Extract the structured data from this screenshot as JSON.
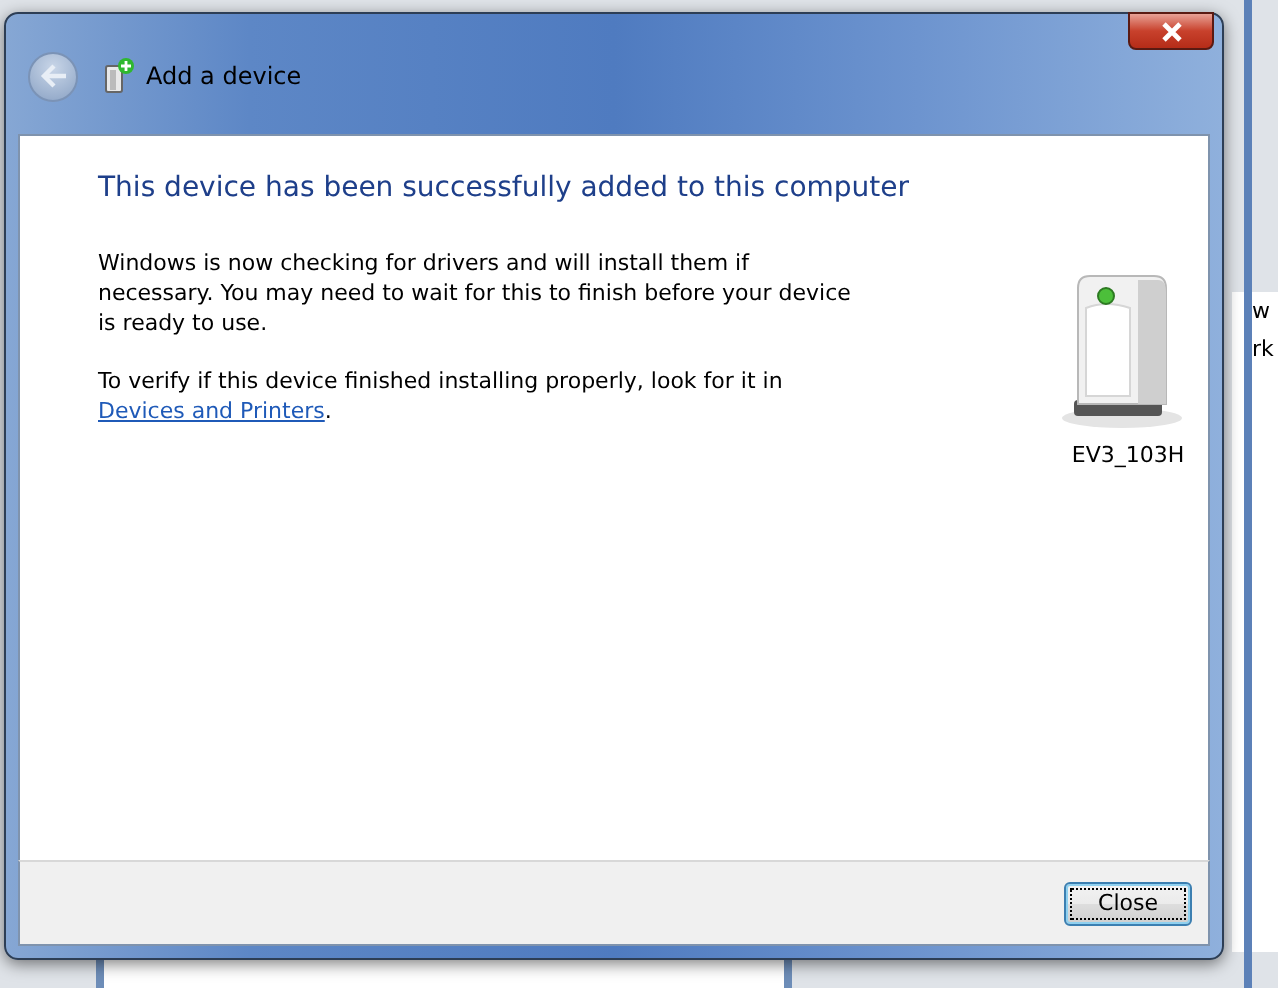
{
  "background": {
    "side_texts": [
      "w",
      "rk"
    ]
  },
  "window": {
    "title": "Add a device"
  },
  "heading": "This device has been successfully added to this computer",
  "paragraphs": [
    "Windows is now checking for drivers and will install them if necessary. You may need to wait for this to finish before your device is ready to use."
  ],
  "verify": {
    "text": "To verify if this device finished installing properly, look for it in",
    "link": "Devices and Printers",
    "after": "."
  },
  "device": {
    "name": "EV3_103H"
  },
  "buttons": [
    {
      "label": "Close",
      "focused": true
    }
  ]
}
